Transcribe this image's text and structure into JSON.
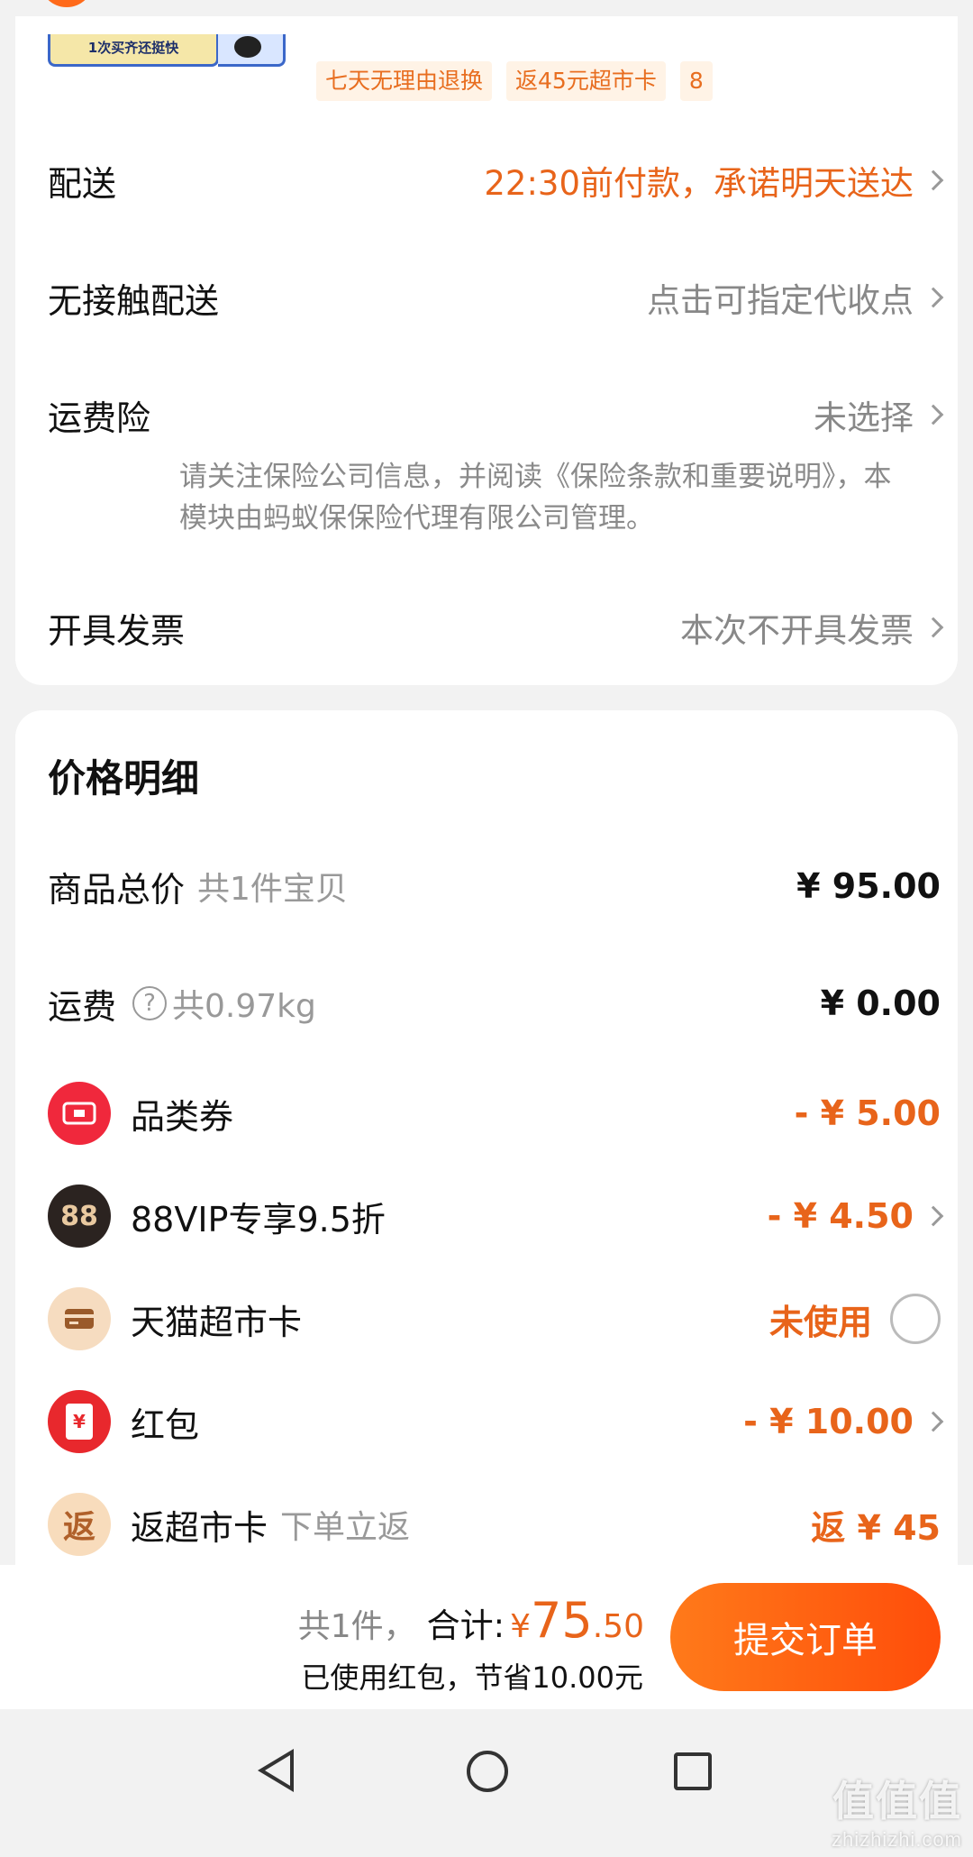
{
  "product": {
    "thumb_caption": "1次买齐还挺快",
    "tags": [
      "七天无理由退换",
      "返45元超市卡",
      "8"
    ]
  },
  "delivery": {
    "shipping_label": "配送",
    "shipping_value": "22:30前付款，承诺明天送达",
    "contactless_label": "无接触配送",
    "contactless_value": "点击可指定代收点",
    "insurance_label": "运费险",
    "insurance_value": "未选择",
    "insurance_note": "请关注保险公司信息，并阅读《保险条款和重要说明》，本模块由蚂蚁保保险代理有限公司管理。",
    "invoice_label": "开具发票",
    "invoice_value": "本次不开具发票"
  },
  "price": {
    "title": "价格明细",
    "goods_label": "商品总价",
    "goods_sub": "共1件宝贝",
    "goods_amount": "¥ 95.00",
    "freight_label": "运费",
    "freight_q": "?",
    "freight_sub": "共0.97kg",
    "freight_amount": "¥ 0.00",
    "coupon_label": "品类券",
    "coupon_amount": "- ¥ 5.00",
    "vip_icon_text": "88",
    "vip_label": "88VIP专享9.5折",
    "vip_amount": "- ¥ 4.50",
    "card_label": "天猫超市卡",
    "card_value": "未使用",
    "hongbao_icon_text": "¥",
    "hongbao_label": "红包",
    "hongbao_amount": "- ¥ 10.00",
    "rebate_icon_text": "返",
    "rebate_label": "返超市卡",
    "rebate_sub": "下单立返",
    "rebate_amount": "返 ¥ 45"
  },
  "summary": {
    "count": "共1件，",
    "total_label": "合计:",
    "currency": "¥",
    "total_int": "75",
    "total_dec": ".50",
    "saved": "已使用红包，节省10.00元",
    "submit": "提交订单"
  },
  "watermark": {
    "cn": "值值值",
    "url": "zhizhizhi.com"
  },
  "colors": {
    "accent": "#e8641a",
    "coupon_icon": "#f0283c",
    "vip_icon": "#2b2320",
    "card_icon": "#f6dcc0",
    "hongbao_icon": "#e8282d",
    "rebate_icon": "#f8dcbc"
  }
}
